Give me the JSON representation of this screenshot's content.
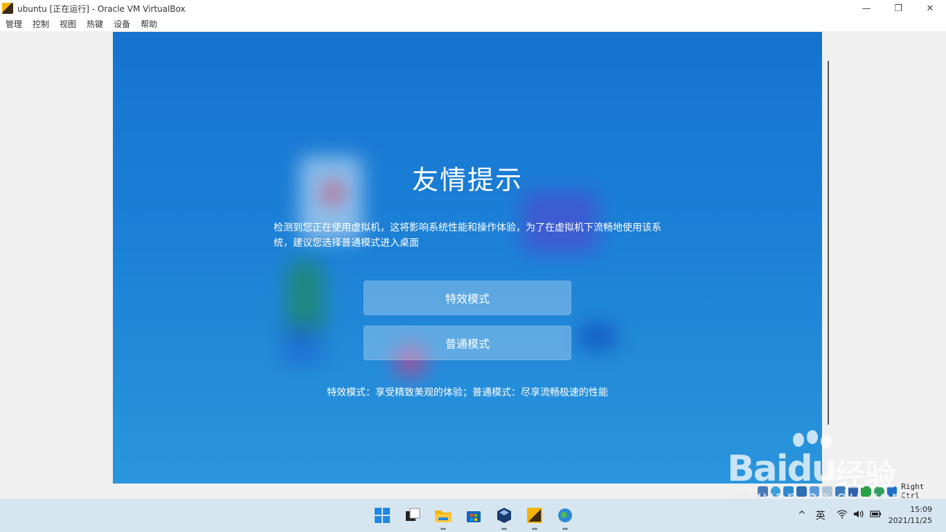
{
  "window": {
    "title": "ubuntu [正在运行] - Oracle VM VirtualBox",
    "controls": {
      "minimize": "—",
      "maximize": "❐",
      "close": "✕"
    }
  },
  "menubar": {
    "items": [
      "管理",
      "控制",
      "视图",
      "热键",
      "设备",
      "帮助"
    ]
  },
  "dialog": {
    "title": "友情提示",
    "message": "检测到您正在使用虚拟机，这将影响系统性能和操作体验，为了在虚拟机下流畅地使用该系统，建议您选择普通模式进入桌面",
    "button_effect": "特效模式",
    "button_normal": "普通模式",
    "description": "特效模式：享受精致美观的体验；普通模式：尽享流畅极速的性能"
  },
  "vbox_status": {
    "host_key": "Right Ctrl",
    "icons": [
      "hdd-icon",
      "optical-icon",
      "audio-icon",
      "network-icon",
      "usb-icon",
      "shared-folder-icon",
      "display-icon",
      "recording-icon",
      "cpu-icon",
      "mouse-integration-icon",
      "keyboard-icon"
    ]
  },
  "watermark": {
    "logo": "Baidu",
    "jingyan": "经验",
    "url": "jingyan.baidu.com"
  },
  "taskbar": {
    "apps": [
      "start-icon",
      "task-view-icon",
      "file-explorer-icon",
      "store-icon",
      "virtualbox-icon",
      "vm-app-icon",
      "network-globe-icon"
    ],
    "ime": "英",
    "time": "15:09",
    "date": "2021/11/25",
    "chevron": "^"
  },
  "colors": {
    "vm_background": "#1b80d6",
    "taskbar": "#d6e6f0",
    "button_bg": "rgba(255,255,255,0.28)"
  }
}
